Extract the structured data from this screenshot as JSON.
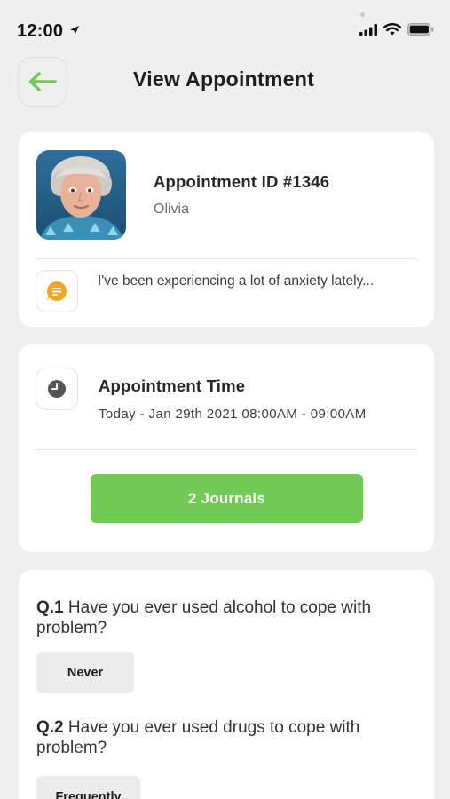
{
  "status_bar": {
    "time": "12:00",
    "icons": [
      "location-arrow-icon",
      "signal-icon",
      "wifi-icon",
      "battery-icon"
    ]
  },
  "header": {
    "title": "View Appointment",
    "back_icon": "arrow-left-icon",
    "accent_color": "#71c956"
  },
  "appointment": {
    "id_label": "Appointment ID #1346",
    "patient_name": "Olivia",
    "message_icon": "chat-bubble-icon",
    "message": "I've been experiencing a lot of anxiety lately...",
    "message_icon_color": "#f5a623"
  },
  "time_card": {
    "icon": "clock-icon",
    "title": "Appointment Time",
    "value": "Today - Jan 29th 2021 08:00AM - 09:00AM",
    "journals_button": "2 Journals"
  },
  "questions": [
    {
      "number": "Q.1",
      "text": "Have you ever used alcohol to cope with problem?",
      "answer": "Never"
    },
    {
      "number": "Q.2",
      "text": "Have you ever used drugs to cope with problem?",
      "answer": "Frequently"
    }
  ]
}
